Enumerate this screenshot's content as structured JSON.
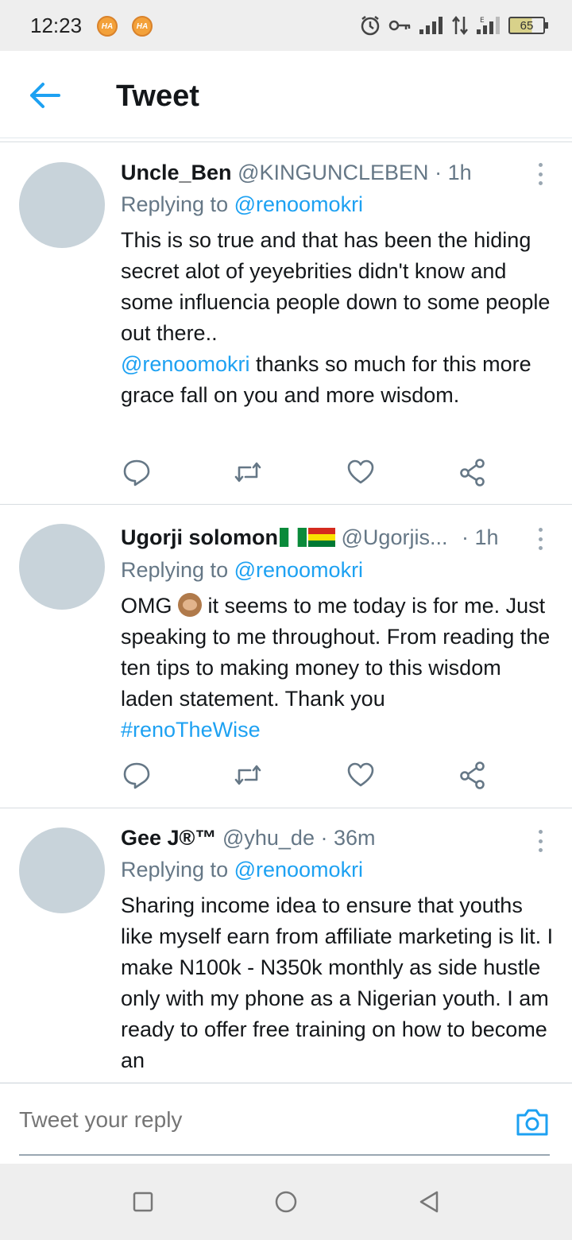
{
  "status_bar": {
    "time": "12:23",
    "notif_badge_1": "HA",
    "notif_badge_2": "HA",
    "battery_level": "65",
    "icons": [
      "alarm-icon",
      "vpn-key-icon",
      "signal-icon",
      "data-transfer-icon",
      "signal-e-icon"
    ]
  },
  "header": {
    "title": "Tweet",
    "back_icon": "arrow-left-icon"
  },
  "tweets": [
    {
      "name": "Uncle_Ben",
      "handle": "@KINGUNCLEBEN",
      "dot": "·",
      "time": "1h",
      "replying_prefix": "Replying to ",
      "replying_to": "@renoomokri",
      "text_part1": "This is so true and that has been the hiding secret alot of yeyebrities didn't know and some influencia people down to some people out there..",
      "mention": "@renoomokri",
      "text_part2": " thanks so much for this more grace fall on you and more wisdom."
    },
    {
      "name": "Ugorji solomon",
      "flags": [
        "Nigeria flag",
        "Bolivia flag"
      ],
      "handle": "@Ugorjis...",
      "dot": "·",
      "time": "1h",
      "replying_prefix": "Replying to ",
      "replying_to": "@renoomokri",
      "text_part1": "OMG ",
      "emoji": "see-no-evil monkey",
      "text_part2": " it seems to me today is for me. Just speaking to me throughout. From reading the ten tips to making money to this wisdom laden statement. Thank you",
      "hashtag": "#renoTheWise"
    },
    {
      "name": "Gee J®™",
      "handle": "@yhu_de",
      "dot": "·",
      "time": "36m",
      "replying_prefix": "Replying to ",
      "replying_to": "@renoomokri",
      "text": "Sharing income idea to ensure that youths like myself earn from affiliate marketing is lit. I make N100k - N350k monthly as side hustle only with my phone as a Nigerian youth. I am ready to offer free training on how to become an"
    }
  ],
  "composer": {
    "placeholder": "Tweet your reply",
    "camera_icon": "camera-icon"
  },
  "colors": {
    "accent": "#1da1f2",
    "secondary_text": "#657786",
    "avatar": "#c8d3da"
  }
}
